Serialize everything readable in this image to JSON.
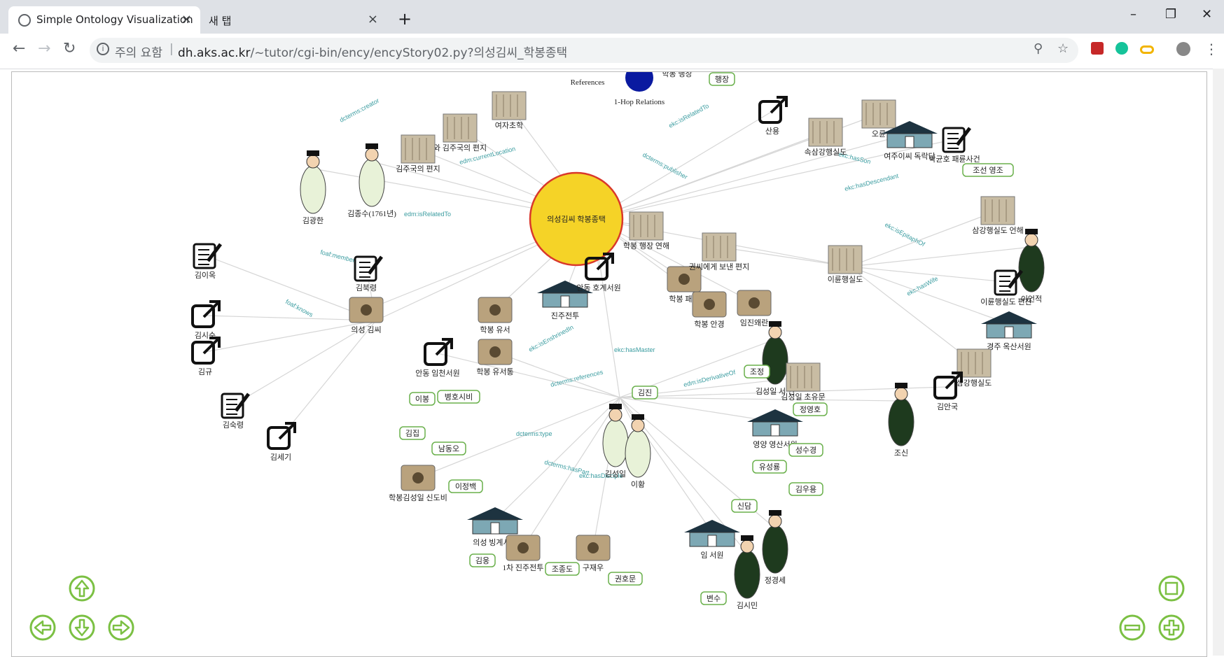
{
  "browser": {
    "tabs": [
      {
        "label": "Simple Ontology Visualization",
        "close": "×",
        "active": true
      },
      {
        "label": "새 탭",
        "close": "×",
        "active": false
      }
    ],
    "new_tab": "+",
    "window_controls": {
      "minimize": "–",
      "restore": "❐",
      "close": "✕"
    },
    "back_icon": "←",
    "forward_icon": "→",
    "reload_icon": "↻",
    "omnibox": {
      "info_icon": "i",
      "security_text": "주의 요함",
      "separator": "|",
      "url_host": "dh.aks.ac.kr",
      "url_path": "/~tutor/cgi-bin/ency/encyStory02.py?의성김씨_학봉종택"
    },
    "toolbar_icons": {
      "zoom": "⚲",
      "star": "☆",
      "menu": "⋮"
    }
  },
  "graph": {
    "center": {
      "label": "의성김씨 학봉종택",
      "color": "#f5d327"
    },
    "legend": {
      "references": "References",
      "one_hop": "1-Hop Relations",
      "one_hop_color": "#0a1aa0",
      "top_partial": "학봉 행장"
    },
    "nodes": [
      {
        "label": "여자초학"
      },
      {
        "label": "와 김주국의 편지"
      },
      {
        "label": "김주국의 편지"
      },
      {
        "label": "김광한"
      },
      {
        "label": "김종수(1761년)"
      },
      {
        "label": "산용"
      },
      {
        "label": "속삼강행실도"
      },
      {
        "label": "오륜"
      },
      {
        "label": "여주이씨 독락당"
      },
      {
        "label": "박균호 패륜사건"
      },
      {
        "label": "학봉 행장 연해"
      },
      {
        "label": "김이옥"
      },
      {
        "label": "김북령"
      },
      {
        "label": "김시순"
      },
      {
        "label": "김규"
      },
      {
        "label": "의성 김씨"
      },
      {
        "label": "김숙령"
      },
      {
        "label": "김세기"
      },
      {
        "label": "진주전투"
      },
      {
        "label": "안동 호계서원"
      },
      {
        "label": "학봉 유서"
      },
      {
        "label": "안동 임천서원"
      },
      {
        "label": "학봉 유서통"
      },
      {
        "label": "학봉 패도"
      },
      {
        "label": "학봉 안경"
      },
      {
        "label": "임진왜란"
      },
      {
        "label": "권씨에게 보낸 편지"
      },
      {
        "label": "이륜행실도"
      },
      {
        "label": "삼강행실도 언해"
      },
      {
        "label": "이언적"
      },
      {
        "label": "이륜행실도 편찬"
      },
      {
        "label": "경주 옥산서원"
      },
      {
        "label": "삼강행실도"
      },
      {
        "label": "김성일 서 연"
      },
      {
        "label": "김성일 초유문"
      },
      {
        "label": "조신"
      },
      {
        "label": "김안국"
      },
      {
        "label": "김성일"
      },
      {
        "label": "이황"
      },
      {
        "label": "영양 영산서원"
      },
      {
        "label": "학봉김성일 신도비"
      },
      {
        "label": "의성 빙계서원"
      },
      {
        "label": "1차 진주전투"
      },
      {
        "label": "정경세"
      },
      {
        "label": "김시민"
      },
      {
        "label": "임 서원"
      },
      {
        "label": "구재우"
      }
    ],
    "tags": [
      "행장",
      "조선 영조",
      "이봉",
      "병호시비",
      "김진",
      "김집",
      "남동오",
      "이정백",
      "조정",
      "정영호",
      "성수경",
      "유성룡",
      "김우용",
      "신담",
      "김웅",
      "조종도",
      "권호문",
      "변수"
    ],
    "edge_labels": [
      "dcterms:creator",
      "edm:currentLocation",
      "edm:isRelatedTo",
      "foaf:member",
      "foaf:knows",
      "ekc:isEnshrinedIn",
      "dcterms:references",
      "ekc:hasMaster",
      "ekc:hasSon",
      "ekc:isEpitaphOf",
      "ekc:hasWife",
      "edm:isDerivativeOf",
      "dcterms:type",
      "dcterms:hasPart",
      "dcterms:publisher",
      "ekc:isRelatedTo",
      "ekc:hasDescendant",
      "ekc:hasDisciple"
    ]
  },
  "controls": {
    "up": "up-arrow-icon",
    "down": "down-arrow-icon",
    "left": "left-arrow-icon",
    "right": "right-arrow-icon",
    "fit": "fit-screen-icon",
    "zoom_out": "minus-icon",
    "zoom_in": "plus-icon",
    "color": "#7bc043"
  }
}
